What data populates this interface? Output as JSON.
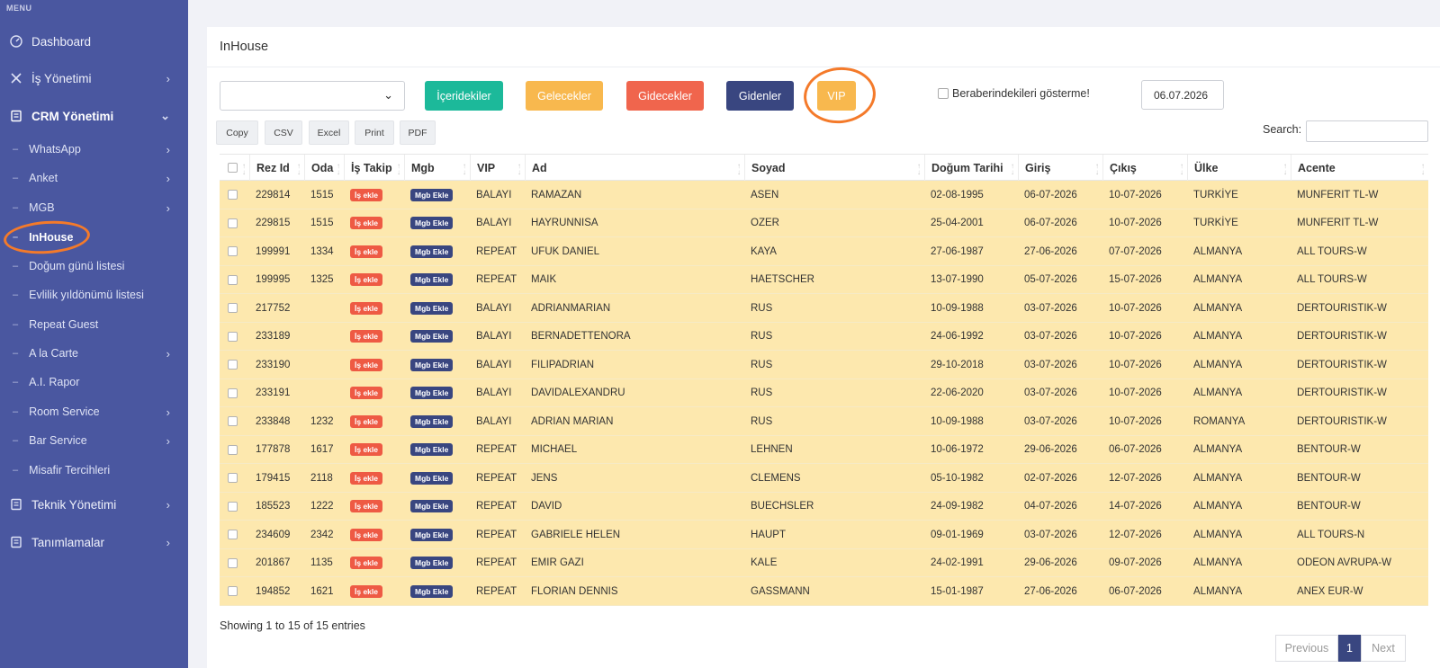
{
  "sidebar": {
    "menu_label": "MENU",
    "items": [
      {
        "label": "Dashboard"
      },
      {
        "label": "İş Yönetimi"
      },
      {
        "label": "CRM Yönetimi"
      },
      {
        "label": "WhatsApp"
      },
      {
        "label": "Anket"
      },
      {
        "label": "MGB"
      },
      {
        "label": "InHouse"
      },
      {
        "label": "Doğum günü listesi"
      },
      {
        "label": "Evlilik yıldönümü listesi"
      },
      {
        "label": "Repeat Guest"
      },
      {
        "label": "A la Carte"
      },
      {
        "label": "A.I. Rapor"
      },
      {
        "label": "Room Service"
      },
      {
        "label": "Bar Service"
      },
      {
        "label": "Misafir Tercihleri"
      },
      {
        "label": "Teknik Yönetimi"
      },
      {
        "label": "Tanımlamalar"
      }
    ]
  },
  "page": {
    "title": "InHouse",
    "select_value": "",
    "buttons": {
      "iceridekiler": "İçeridekiler",
      "gelecekler": "Gelecekler",
      "gidecekler": "Gidecekler",
      "gidenler": "Gidenler",
      "vip": "VIP"
    },
    "checkbox_label": "Beraberindekileri gösterme!",
    "date_value": "06.07.2026",
    "export": {
      "copy": "Copy",
      "csv": "CSV",
      "excel": "Excel",
      "print": "Print",
      "pdf": "PDF"
    },
    "search_label": "Search:",
    "search_value": ""
  },
  "table": {
    "headers": [
      "Rez Id",
      "Oda",
      "İş Takip",
      "Mgb",
      "VIP",
      "Ad",
      "Soyad",
      "Doğum Tarihi",
      "Giriş",
      "Çıkış",
      "Ülke",
      "Acente"
    ],
    "is_badge": "İş ekle",
    "mgb_badge": "Mgb Ekle",
    "rows": [
      {
        "rez": "229814",
        "oda": "1515",
        "vip": "BALAYI",
        "ad": "RAMAZAN",
        "soyad": "ASEN",
        "dogum": "02-08-1995",
        "giris": "06-07-2026",
        "cikis": "10-07-2026",
        "ulke": "TURKİYE",
        "acente": "MUNFERIT TL-W"
      },
      {
        "rez": "229815",
        "oda": "1515",
        "vip": "BALAYI",
        "ad": "HAYRUNNISA",
        "soyad": "OZER",
        "dogum": "25-04-2001",
        "giris": "06-07-2026",
        "cikis": "10-07-2026",
        "ulke": "TURKİYE",
        "acente": "MUNFERIT TL-W"
      },
      {
        "rez": "199991",
        "oda": "1334",
        "vip": "REPEAT",
        "ad": "UFUK DANIEL",
        "soyad": "KAYA",
        "dogum": "27-06-1987",
        "giris": "27-06-2026",
        "cikis": "07-07-2026",
        "ulke": "ALMANYA",
        "acente": "ALL TOURS-W"
      },
      {
        "rez": "199995",
        "oda": "1325",
        "vip": "REPEAT",
        "ad": "MAIK",
        "soyad": "HAETSCHER",
        "dogum": "13-07-1990",
        "giris": "05-07-2026",
        "cikis": "15-07-2026",
        "ulke": "ALMANYA",
        "acente": "ALL TOURS-W"
      },
      {
        "rez": "217752",
        "oda": "",
        "vip": "BALAYI",
        "ad": "ADRIANMARIAN",
        "soyad": "RUS",
        "dogum": "10-09-1988",
        "giris": "03-07-2026",
        "cikis": "10-07-2026",
        "ulke": "ALMANYA",
        "acente": "DERTOURISTIK-W"
      },
      {
        "rez": "233189",
        "oda": "",
        "vip": "BALAYI",
        "ad": "BERNADETTENORA",
        "soyad": "RUS",
        "dogum": "24-06-1992",
        "giris": "03-07-2026",
        "cikis": "10-07-2026",
        "ulke": "ALMANYA",
        "acente": "DERTOURISTIK-W"
      },
      {
        "rez": "233190",
        "oda": "",
        "vip": "BALAYI",
        "ad": "FILIPADRIAN",
        "soyad": "RUS",
        "dogum": "29-10-2018",
        "giris": "03-07-2026",
        "cikis": "10-07-2026",
        "ulke": "ALMANYA",
        "acente": "DERTOURISTIK-W"
      },
      {
        "rez": "233191",
        "oda": "",
        "vip": "BALAYI",
        "ad": "DAVIDALEXANDRU",
        "soyad": "RUS",
        "dogum": "22-06-2020",
        "giris": "03-07-2026",
        "cikis": "10-07-2026",
        "ulke": "ALMANYA",
        "acente": "DERTOURISTIK-W"
      },
      {
        "rez": "233848",
        "oda": "1232",
        "vip": "BALAYI",
        "ad": "ADRIAN MARIAN",
        "soyad": "RUS",
        "dogum": "10-09-1988",
        "giris": "03-07-2026",
        "cikis": "10-07-2026",
        "ulke": "ROMANYA",
        "acente": "DERTOURISTIK-W"
      },
      {
        "rez": "177878",
        "oda": "1617",
        "vip": "REPEAT",
        "ad": "MICHAEL",
        "soyad": "LEHNEN",
        "dogum": "10-06-1972",
        "giris": "29-06-2026",
        "cikis": "06-07-2026",
        "ulke": "ALMANYA",
        "acente": "BENTOUR-W"
      },
      {
        "rez": "179415",
        "oda": "2118",
        "vip": "REPEAT",
        "ad": "JENS",
        "soyad": "CLEMENS",
        "dogum": "05-10-1982",
        "giris": "02-07-2026",
        "cikis": "12-07-2026",
        "ulke": "ALMANYA",
        "acente": "BENTOUR-W"
      },
      {
        "rez": "185523",
        "oda": "1222",
        "vip": "REPEAT",
        "ad": "DAVID",
        "soyad": "BUECHSLER",
        "dogum": "24-09-1982",
        "giris": "04-07-2026",
        "cikis": "14-07-2026",
        "ulke": "ALMANYA",
        "acente": "BENTOUR-W"
      },
      {
        "rez": "234609",
        "oda": "2342",
        "vip": "REPEAT",
        "ad": "GABRIELE HELEN",
        "soyad": "HAUPT",
        "dogum": "09-01-1969",
        "giris": "03-07-2026",
        "cikis": "12-07-2026",
        "ulke": "ALMANYA",
        "acente": "ALL TOURS-N"
      },
      {
        "rez": "201867",
        "oda": "1135",
        "vip": "REPEAT",
        "ad": "EMIR GAZI",
        "soyad": "KALE",
        "dogum": "24-02-1991",
        "giris": "29-06-2026",
        "cikis": "09-07-2026",
        "ulke": "ALMANYA",
        "acente": "ODEON AVRUPA-W"
      },
      {
        "rez": "194852",
        "oda": "1621",
        "vip": "REPEAT",
        "ad": "FLORIAN DENNIS",
        "soyad": "GASSMANN",
        "dogum": "15-01-1987",
        "giris": "27-06-2026",
        "cikis": "06-07-2026",
        "ulke": "ALMANYA",
        "acente": "ANEX EUR-W"
      }
    ]
  },
  "footer": {
    "showing": "Showing 1 to 15 of 15 entries",
    "previous": "Previous",
    "current_page": "1",
    "next": "Next"
  },
  "colors": {
    "sidebar_bg": "#4a57a0",
    "row_highlight": "#fde8ae",
    "accent_navy": "#394680",
    "annotation_orange": "#f47a2a"
  }
}
